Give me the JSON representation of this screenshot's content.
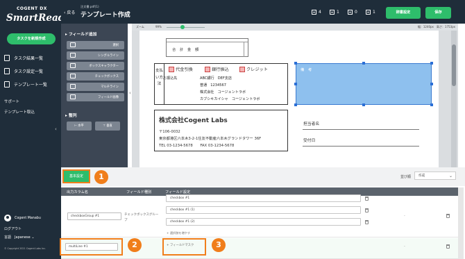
{
  "sidebar": {
    "brand_top": "COGENT DX",
    "brand": "SmartRead",
    "new_task": "タスクを新規作成",
    "items": [
      {
        "label": "タスク結果一覧",
        "icon": "document-icon"
      },
      {
        "label": "タスク設定一覧",
        "icon": "settings-list-icon"
      },
      {
        "label": "テンプレート一覧",
        "icon": "template-icon"
      }
    ],
    "support": "サポート",
    "template_import": "テンプレート取込",
    "user_name": "Cogent Manabu",
    "logout": "ログアウト",
    "language_label": "言語",
    "language_value": "Japanese",
    "copyright": "© Copyright 2021 Cogent Labs Inc."
  },
  "header": {
    "back": "戻る",
    "breadcrumb": "注文書.pdf(1)",
    "title": "テンプレート作成",
    "stats": [
      "4",
      "1",
      "0",
      "1"
    ],
    "dictionary_button": "辞書設定",
    "save_button": "保存"
  },
  "field_panel": {
    "add_title": "フィールド追加",
    "tools": [
      "選択",
      "シングルライン",
      "ボックスキャラクター",
      "チェックボックス",
      "マルチライン",
      "フィールド画像"
    ],
    "align_title": "整列",
    "align_tools": [
      "水平",
      "垂直"
    ]
  },
  "canvas": {
    "zoom_label": "ズーム",
    "zoom_value": "99%",
    "size_info": "幅：1240px　高さ：1753px",
    "total_label": "合 計 金 額",
    "pay_label": "支払い方法",
    "checkboxes": [
      "代金引換",
      "銀行振込",
      "クレジット"
    ],
    "bank_lines": [
      "お振込先",
      "ABC銀行　DEF支店",
      "普通　1234567",
      "株式会社　コージェントラボ",
      "カブシキカイシャ　コージェントラボ"
    ],
    "notes_label": "備 考",
    "company_name": "株式会社Cogent Labs",
    "company_lines": [
      "〒106-0032",
      "東京都港区六本木3-2-1住友不動産六本木グランドタワー 36F",
      "TEL 03-1234-5678　　FAX 03-1234-5678"
    ],
    "form_fields": [
      "担当者名",
      "受付日"
    ]
  },
  "callouts": [
    "1",
    "2",
    "3"
  ],
  "bottom": {
    "tab_basic": "基本設定",
    "binding_label": "並び順",
    "binding_value": "作成",
    "table_headers": [
      "出力カラム名",
      "フィールド種別",
      "フィールド設定"
    ],
    "checkbox_group": {
      "column_name": "checkboxGroup #1",
      "field_type": "チェックボックスグループ",
      "options": [
        "checkbox #1",
        "checkbox #1 (1)",
        "checkbox #1 (2)",
        "checkbox #1 (3)"
      ],
      "add_option": "+ 選択肢を増やす"
    },
    "multiline": {
      "column_name": "multiLine #1",
      "add_field": "+ フィールドマスク"
    },
    "dash": "-"
  }
}
